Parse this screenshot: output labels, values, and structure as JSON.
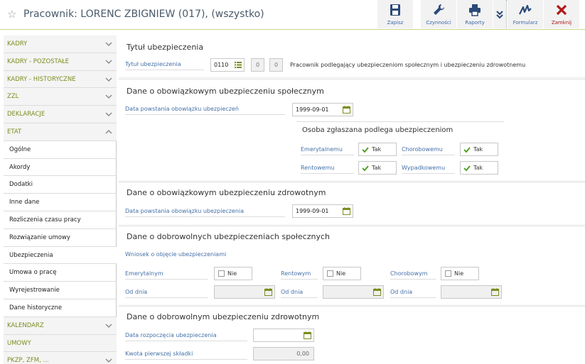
{
  "header": {
    "title": "Pracownik: LORENC ZBIGNIEW (017), (wszystko)",
    "toolbar": {
      "save_label": "Zapisz",
      "actions_label": "Czynności",
      "reports_label": "Raporty",
      "form_label": "Formularz",
      "close_label": "Zamknij"
    }
  },
  "sidebar": {
    "items": [
      {
        "label": "KADRY"
      },
      {
        "label": "KADRY - POZOSTAŁE"
      },
      {
        "label": "KADRY - HISTORYCZNE"
      },
      {
        "label": "ZZL"
      },
      {
        "label": "DEKLARACJE"
      },
      {
        "label": "ETAT"
      },
      {
        "label": "Ogólne"
      },
      {
        "label": "Akordy"
      },
      {
        "label": "Dodatki"
      },
      {
        "label": "Inne dane"
      },
      {
        "label": "Rozliczenia czasu pracy"
      },
      {
        "label": "Rozwiązanie umowy"
      },
      {
        "label": "Ubezpieczenia"
      },
      {
        "label": "Umowa o pracę"
      },
      {
        "label": "Wyrejestrowanie"
      },
      {
        "label": "Dane historyczne"
      },
      {
        "label": "KALENDARZ"
      },
      {
        "label": "UMOWY"
      },
      {
        "label": "PKZP, ZFM, ..."
      }
    ]
  },
  "insurance_title": {
    "section_title": "Tytuł ubezpieczenia",
    "field_label": "Tytuł ubezpieczenia",
    "code": "0110",
    "extra1": "0",
    "extra2": "0",
    "description": "Pracownik podlegający ubezpieczeniom społecznym i ubezpieczeniu zdrowotnemu"
  },
  "mandatory_social": {
    "section_title": "Dane o obowiązkowym ubezpieczeniu społecznym",
    "date_label": "Data powstania obowiązku ubezpieczeń",
    "date_value": "1999-09-01",
    "subsection_title": "Osoba zgłaszana podlega ubezpieczeniom",
    "pension_label": "Emerytalnemu",
    "pension_value": "Tak",
    "sickness_label": "Chorobowemu",
    "sickness_value": "Tak",
    "disability_label": "Rentowemu",
    "disability_value": "Tak",
    "accident_label": "Wypadkowemu",
    "accident_value": "Tak"
  },
  "mandatory_health": {
    "section_title": "Dane o obowiązkowym ubezpieczeniu zdrowotnym",
    "date_label": "Data powstania obowiązku ubezpieczenia",
    "date_value": "1999-09-01"
  },
  "voluntary_social": {
    "section_title": "Dane o dobrowolnych ubezpieczeniach społecznych",
    "request_label": "Wniosek o objęcie ubezpieczeniami",
    "pension_label": "Emerytalnym",
    "pension_value": "Nie",
    "disability_label": "Rentowym",
    "disability_value": "Nie",
    "sickness_label": "Chorobowym",
    "sickness_value": "Nie",
    "from_label": "Od dnia"
  },
  "voluntary_health": {
    "section_title": "Dane o dobrowolnym ubezpieczeniu zdrowotnym",
    "start_label": "Data rozpoczęcia ubezpieczenia",
    "start_value": "",
    "amount_label": "Kwota pierwszej składki",
    "amount_value": "0,00"
  },
  "colors": {
    "accent": "#7a8d1f",
    "label_blue": "#4470a8",
    "check_green": "#4a9a1a",
    "close_red": "#b01818"
  }
}
